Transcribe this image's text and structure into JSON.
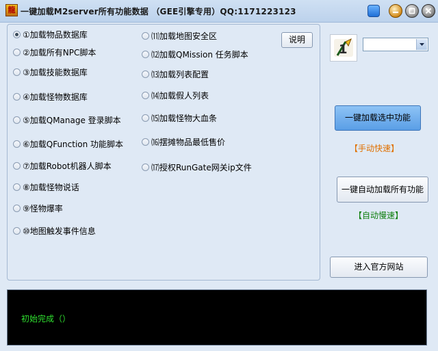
{
  "window": {
    "title": "一键加载M2server所有功能数据 （GEE引擎专用）QQ:1171223123"
  },
  "options_left": [
    {
      "label": "①加载物品数据库",
      "checked": true
    },
    {
      "label": "②加载所有NPC脚本",
      "checked": false
    },
    {
      "label": "③加载技能数据库",
      "checked": false
    },
    {
      "label": "④加载怪物数据库",
      "checked": false
    },
    {
      "label": "⑤加载QManage 登录脚本",
      "checked": false
    },
    {
      "label": "⑥加载QFunction 功能脚本",
      "checked": false
    },
    {
      "label": "⑦加载Robot机器人脚本",
      "checked": false
    },
    {
      "label": "⑧加载怪物说话",
      "checked": false
    },
    {
      "label": "⑨怪物爆率",
      "checked": false
    },
    {
      "label": "⑩地图触发事件信息",
      "checked": false
    }
  ],
  "options_right": [
    {
      "label": "⑾加载地图安全区",
      "checked": false
    },
    {
      "label": "⑿加载QMission 任务脚本",
      "checked": false
    },
    {
      "label": "⒀加载列表配置",
      "checked": false
    },
    {
      "label": "⒁加载假人列表",
      "checked": false
    },
    {
      "label": "⒂加载怪物大血条",
      "checked": false
    },
    {
      "label": "⒃摆摊物品最低售价",
      "checked": false
    },
    {
      "label": "⒄授权RunGate网关ip文件",
      "checked": false
    }
  ],
  "buttons": {
    "help": "说明",
    "load_selected": "一键加载选中功能",
    "load_all": "一键自动加载所有功能",
    "website": "进入官方网站"
  },
  "tags": {
    "manual_fast": "【手动快速】",
    "auto_slow": "【自动慢速】"
  },
  "select": {
    "value": ""
  },
  "console": {
    "text": "初始完成（）"
  },
  "colors": {
    "manual_fast": "#e07000",
    "auto_slow": "#108010",
    "console_text": "#2fe02f"
  }
}
